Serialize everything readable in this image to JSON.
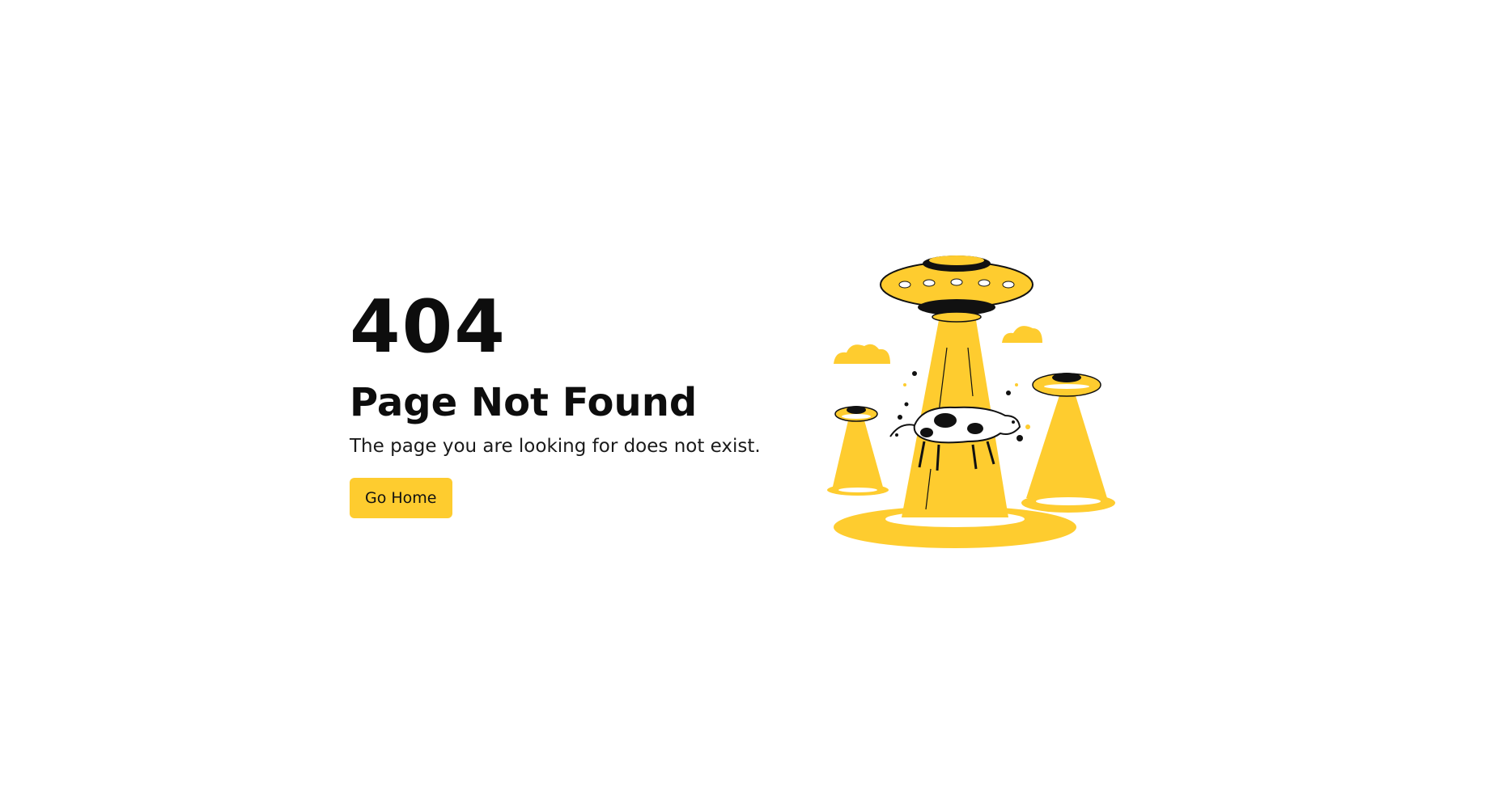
{
  "error": {
    "code": "404",
    "title": "Page Not Found",
    "message": "The page you are looking for does not exist."
  },
  "actions": {
    "go_home_label": "Go Home"
  },
  "illustration": {
    "icon": "ufo-cow-abduction-illustration"
  },
  "colors": {
    "accent": "#fecc2f",
    "text": "#0d0d0d",
    "background": "#ffffff"
  }
}
